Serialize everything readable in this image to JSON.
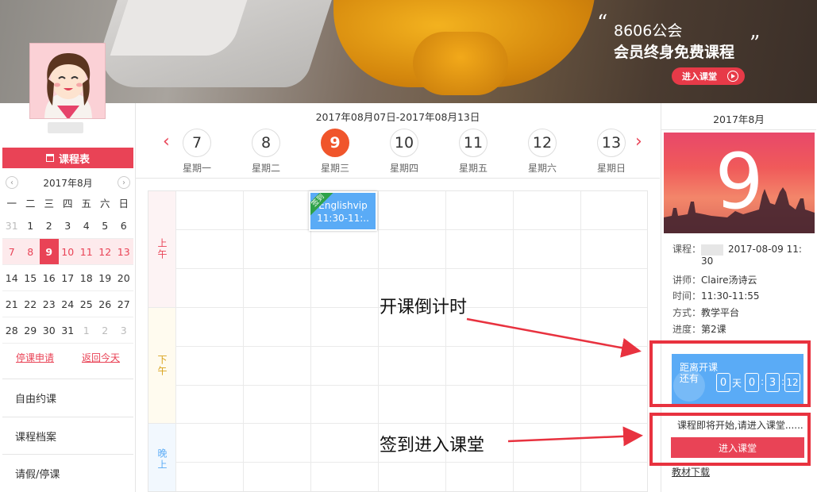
{
  "banner": {
    "quote_open": "“",
    "quote_close": "”",
    "line1": "8606公会",
    "line2": "会员终身免费课程",
    "enter_button": "进入课堂"
  },
  "sidebar": {
    "schedule_header": "课程表",
    "mini_calendar": {
      "title": "2017年8月",
      "prev": "‹",
      "next": "›",
      "weekdays": [
        "一",
        "二",
        "三",
        "四",
        "五",
        "六",
        "日"
      ],
      "rows": [
        [
          "31",
          "1",
          "2",
          "3",
          "4",
          "5",
          "6"
        ],
        [
          "7",
          "8",
          "9",
          "10",
          "11",
          "12",
          "13"
        ],
        [
          "14",
          "15",
          "16",
          "17",
          "18",
          "19",
          "20"
        ],
        [
          "21",
          "22",
          "23",
          "24",
          "25",
          "26",
          "27"
        ],
        [
          "28",
          "29",
          "30",
          "31",
          "1",
          "2",
          "3"
        ]
      ],
      "today": "9"
    },
    "links": {
      "suspend": "停课申请",
      "back_today": "返回今天"
    },
    "menu": [
      "自由约课",
      "课程档案",
      "请假/停课"
    ]
  },
  "week": {
    "range": "2017年08月07日-2017年08月13日",
    "prev": "‹",
    "next": "›",
    "days": [
      {
        "num": "7",
        "label": "星期一"
      },
      {
        "num": "8",
        "label": "星期二"
      },
      {
        "num": "9",
        "label": "星期三"
      },
      {
        "num": "10",
        "label": "星期四"
      },
      {
        "num": "11",
        "label": "星期五"
      },
      {
        "num": "12",
        "label": "星期六"
      },
      {
        "num": "13",
        "label": "星期日"
      }
    ],
    "active_day": "9"
  },
  "slots": {
    "morning": "上午",
    "afternoon": "下午",
    "evening": "晚上"
  },
  "class_card": {
    "ribbon": "签到",
    "name": "Englishvip",
    "time": "11:30-11:.."
  },
  "annotations": {
    "countdown": "开课倒计时",
    "enter": "签到进入课堂"
  },
  "right_panel": {
    "month": "2017年8月",
    "big_day": "9",
    "course_label": "课程：",
    "course_value": "2017-08-09 11:",
    "course_value2": "30",
    "teacher_label": "讲师：",
    "teacher_value": "Claire汤诗云",
    "time_label": "时间：",
    "time_value": "11:30-11:55",
    "mode_label": "方式：",
    "mode_value": "教学平台",
    "progress_label": "进度：",
    "progress_value": "第2课",
    "countdown": {
      "label": "距离开课还有",
      "days": "0",
      "days_unit": "天",
      "hours": "0",
      "minutes": "3",
      "seconds": "12",
      "sep": ":"
    },
    "starting_soon": "课程即将开始,请进入课堂......",
    "enter_button": "进入课堂",
    "materials_link": "教材下载"
  },
  "colors": {
    "accent_red": "#e94356",
    "class_blue": "#5aabf6",
    "active_orange": "#f0552b"
  }
}
